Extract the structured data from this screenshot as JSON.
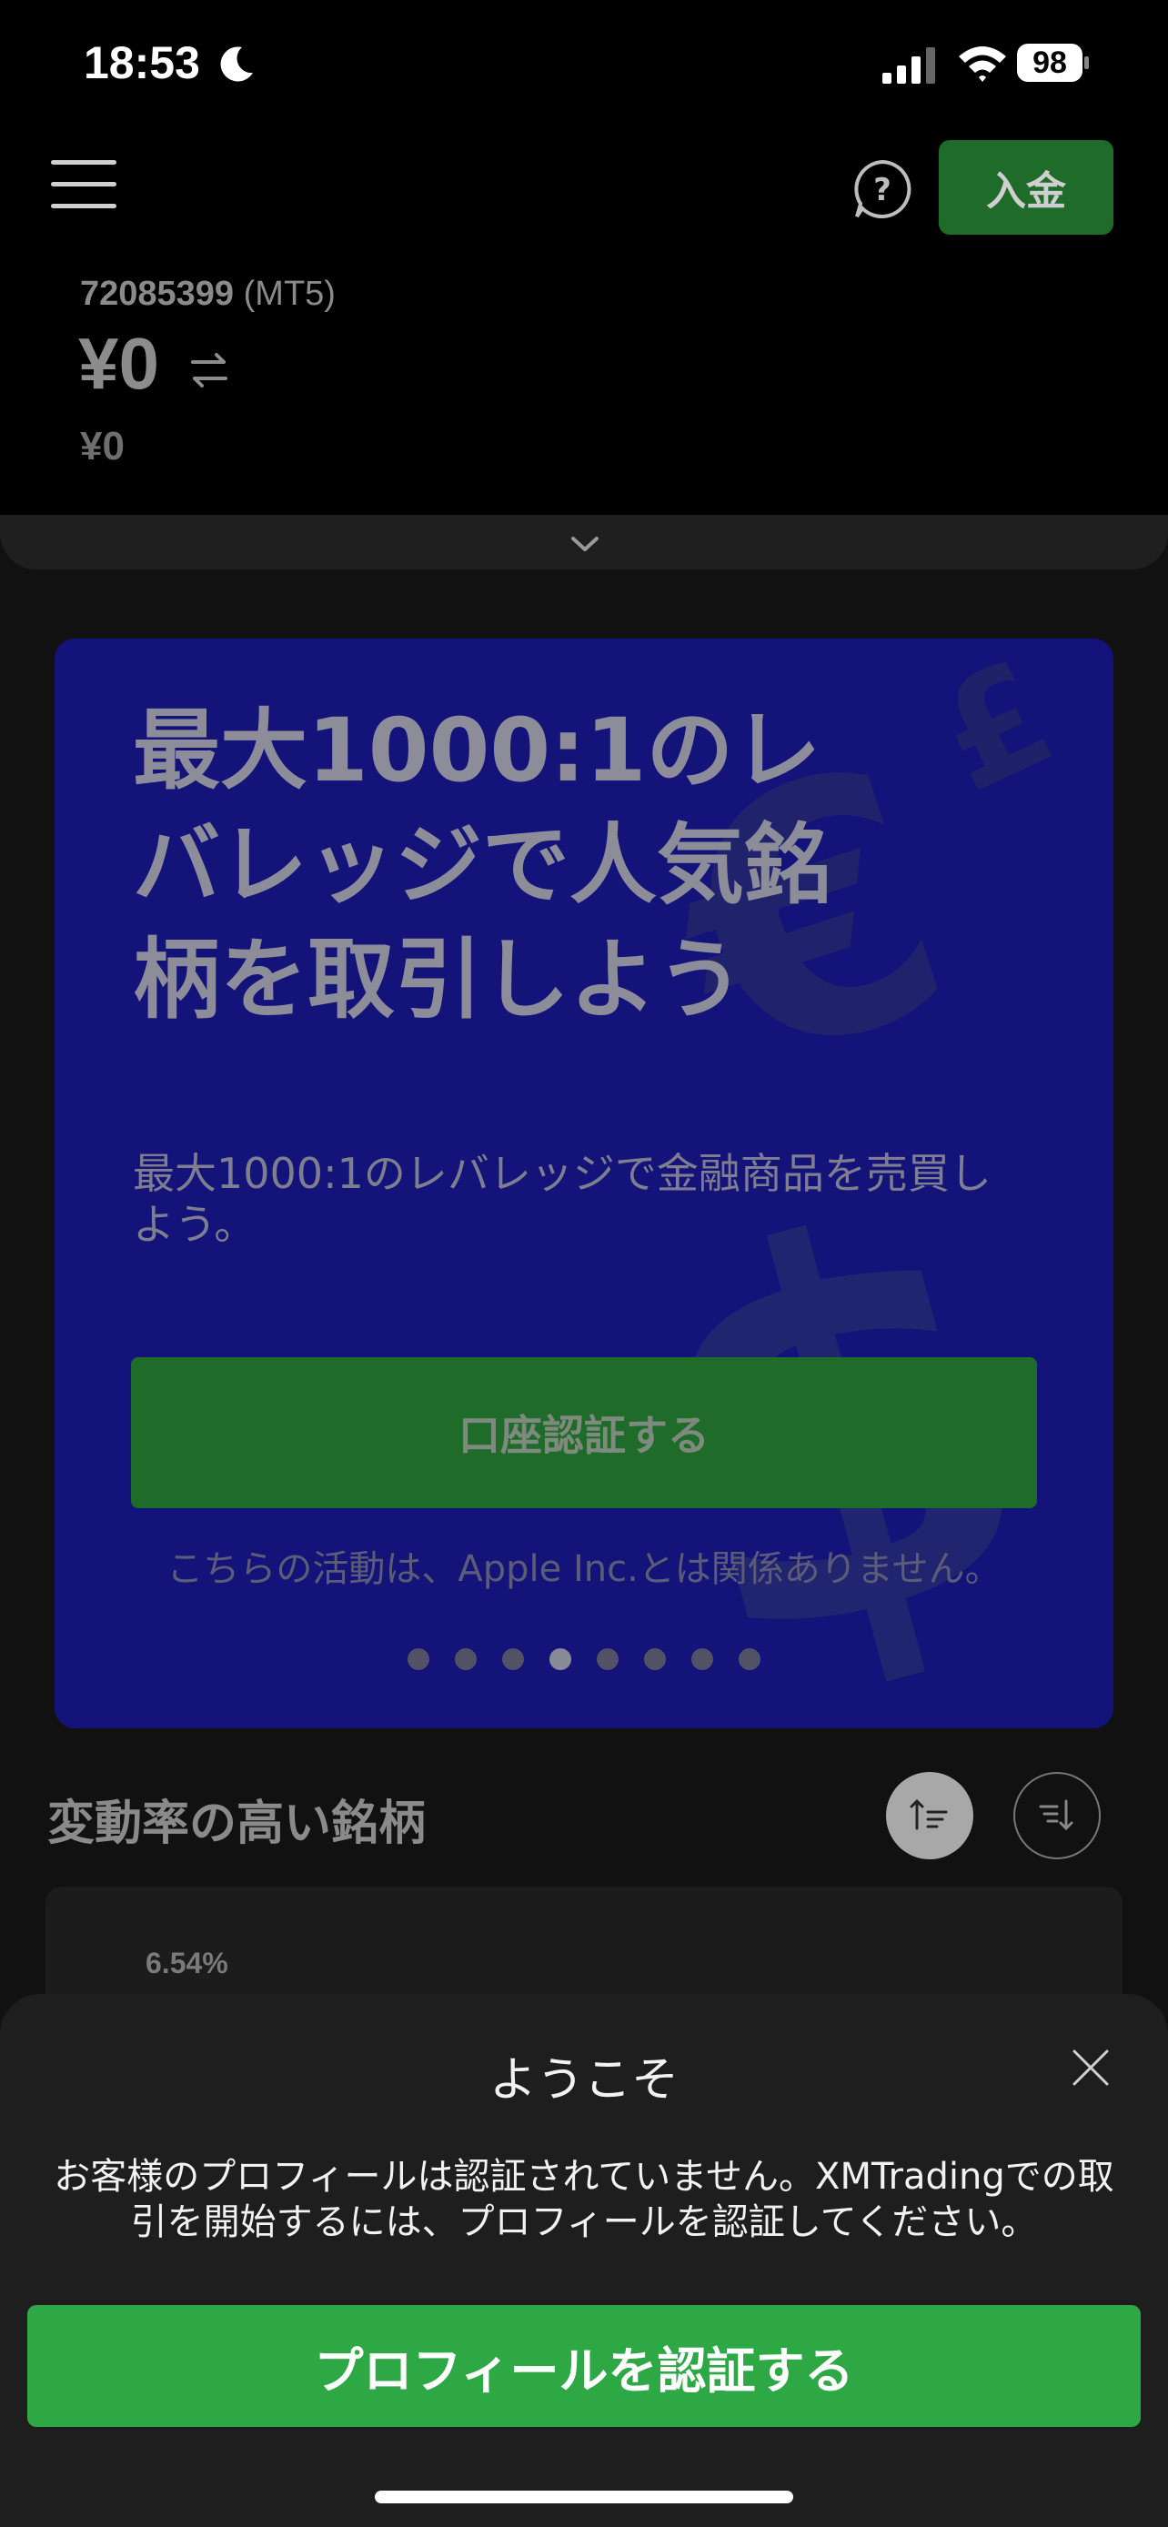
{
  "status_bar": {
    "time": "18:53",
    "battery": "98"
  },
  "header": {
    "deposit_label": "入金",
    "account_number": "72085399",
    "account_type": "(MT5)",
    "balance": "¥0",
    "equity": "¥0"
  },
  "promo": {
    "title": "最大1000:1のレバレッジで人気銘柄を取引しよう",
    "subtitle": "最大1000:1のレバレッジで金融商品を売買しよう。",
    "button_label": "口座認証する",
    "disclaimer": "こちらの活動は、Apple Inc.とは関係ありません。",
    "carousel": {
      "total": 8,
      "active_index": 3
    }
  },
  "volatile": {
    "title": "変動率の高い銘柄",
    "first_item_change": "6.54%"
  },
  "sheet": {
    "title": "ようこそ",
    "message": "お客様のプロフィールは認証されていません。XMTradingでの取引を開始するには、プロフィールを認証してください。",
    "button_label": "プロフィールを認証する"
  },
  "icons": [
    "moon-icon",
    "signal-icon",
    "wifi-icon",
    "battery-icon",
    "menu-icon",
    "help-icon",
    "swap-icon",
    "chevron-down-icon",
    "sort-ascending-icon",
    "sort-descending-icon",
    "close-icon"
  ],
  "colors": {
    "deposit_green": "#1e6b2a",
    "promo_bg": "#13137a",
    "primary_green": "#2ea844",
    "sheet_bg": "#1e1e1e"
  }
}
